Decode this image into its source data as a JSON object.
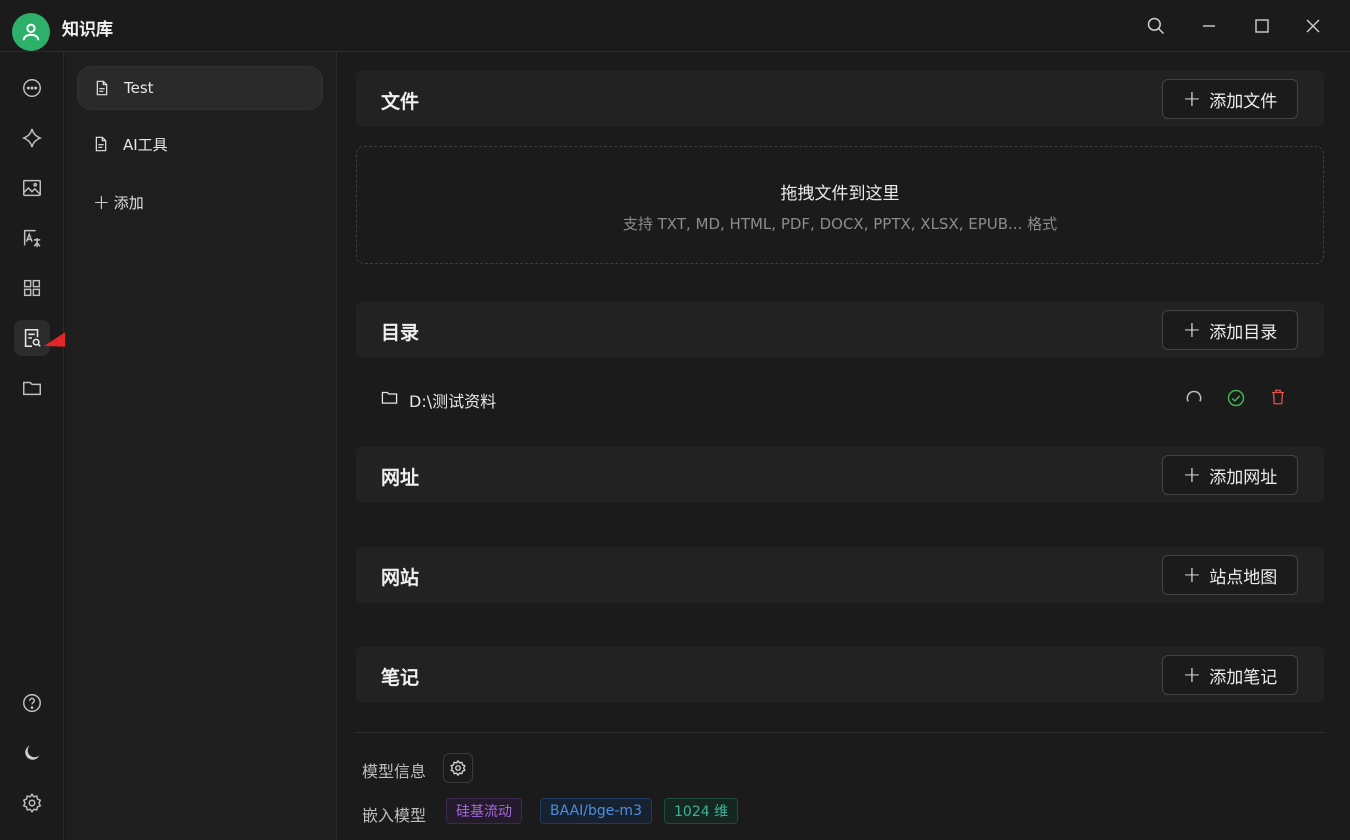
{
  "app": {
    "title": "知识库"
  },
  "knowledge_bases": [
    {
      "label": "Test",
      "active": true
    },
    {
      "label": "AI工具",
      "active": false
    }
  ],
  "kb_add_label": "添加",
  "sections": {
    "files": {
      "title": "文件",
      "button": "添加文件"
    },
    "dropzone": {
      "title": "拖拽文件到这里",
      "subtitle": "支持 TXT, MD, HTML, PDF, DOCX, PPTX, XLSX, EPUB... 格式"
    },
    "directory": {
      "title": "目录",
      "button": "添加目录",
      "items": [
        {
          "path": "D:\\测试资料"
        }
      ]
    },
    "url": {
      "title": "网址",
      "button": "添加网址"
    },
    "website": {
      "title": "网站",
      "button": "站点地图"
    },
    "notes": {
      "title": "笔记",
      "button": "添加笔记"
    }
  },
  "model": {
    "info_label": "模型信息",
    "embed_label": "嵌入模型",
    "tags": [
      {
        "text": "硅基流动",
        "color": "#a46ad8"
      },
      {
        "text": "BAAI/bge-m3",
        "color": "#4a8fe0"
      },
      {
        "text": "1024 维",
        "color": "#3fb39a"
      }
    ]
  },
  "icons": {
    "rail": [
      "chat-icon",
      "sparkle-icon",
      "image-icon",
      "translate-icon",
      "apps-icon",
      "knowledge-icon",
      "folder-icon",
      "help-icon",
      "moon-icon",
      "settings-icon"
    ],
    "active_rail": "knowledge-icon"
  },
  "colors": {
    "accent": "#2db069",
    "annotation_arrow": "#e0262b",
    "ok": "#3fb34f",
    "danger": "#e05050"
  }
}
